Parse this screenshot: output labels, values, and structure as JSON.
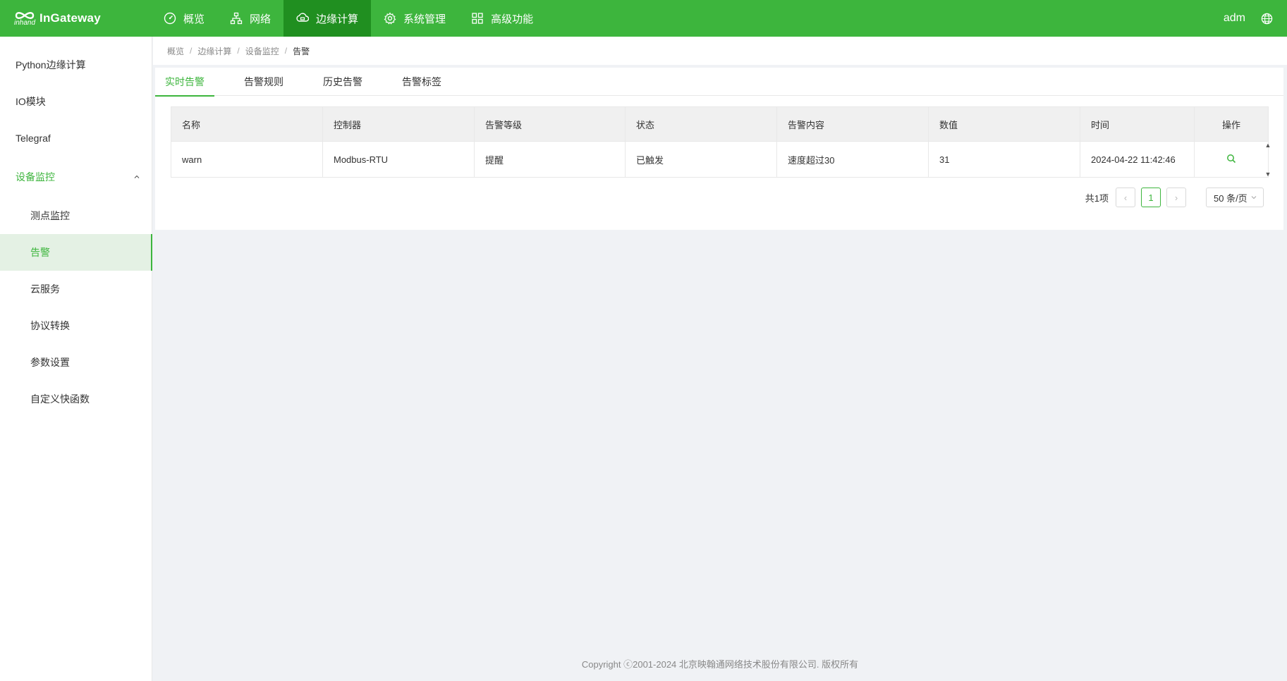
{
  "brand": {
    "name": "InGateway",
    "sub": "inhand"
  },
  "nav": [
    {
      "label": "概览",
      "icon": "dashboard-icon"
    },
    {
      "label": "网络",
      "icon": "network-icon"
    },
    {
      "label": "边缘计算",
      "icon": "edge-computing-icon"
    },
    {
      "label": "系统管理",
      "icon": "gear-icon"
    },
    {
      "label": "高级功能",
      "icon": "grid-icon"
    }
  ],
  "user": {
    "name": "adm"
  },
  "sidebar": {
    "items": [
      {
        "label": "Python边缘计算"
      },
      {
        "label": "IO模块"
      },
      {
        "label": "Telegraf"
      }
    ],
    "group": {
      "label": "设备监控",
      "children": [
        {
          "label": "测点监控"
        },
        {
          "label": "告警"
        },
        {
          "label": "云服务"
        },
        {
          "label": "协议转换"
        },
        {
          "label": "参数设置"
        },
        {
          "label": "自定义快函数"
        }
      ]
    }
  },
  "breadcrumb": [
    "概览",
    "边缘计算",
    "设备监控",
    "告警"
  ],
  "tabs": [
    "实时告警",
    "告警规则",
    "历史告警",
    "告警标签"
  ],
  "table": {
    "headers": [
      "名称",
      "控制器",
      "告警等级",
      "状态",
      "告警内容",
      "数值",
      "时间",
      "操作"
    ],
    "rows": [
      [
        "warn",
        "Modbus-RTU",
        "提醒",
        "已触发",
        "速度超过30",
        "31",
        "2024-04-22 11:42:46"
      ]
    ]
  },
  "pagination": {
    "total": "共1项",
    "current": "1",
    "page_size": "50 条/页"
  },
  "footer": "Copyright ⓒ2001-2024 北京映翰通网络技术股份有限公司. 版权所有",
  "colors": {
    "primary": "#3db53d",
    "primary_dark": "#208f20"
  }
}
